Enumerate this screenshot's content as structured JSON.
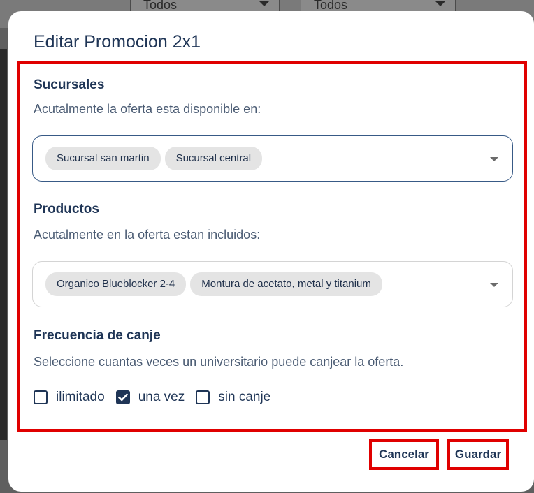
{
  "background": {
    "filter_a": "Todos",
    "filter_b": "Todos"
  },
  "modal": {
    "title": "Editar Promocion 2x1"
  },
  "sucursales": {
    "title": "Sucursales",
    "subtitle": "Acutalmente la oferta esta disponible en:",
    "chips": [
      "Sucursal san martin",
      "Sucursal central"
    ]
  },
  "productos": {
    "title": "Productos",
    "subtitle": "Acutalmente en la oferta estan incluidos:",
    "chips": [
      "Organico Blueblocker 2-4",
      "Montura de acetato, metal y titanium"
    ]
  },
  "frecuencia": {
    "title": "Frecuencia de canje",
    "subtitle": "Seleccione cuantas veces un universitario puede canjear la oferta.",
    "options": [
      {
        "label": "ilimitado",
        "checked": false
      },
      {
        "label": "una vez",
        "checked": true
      },
      {
        "label": "sin canje",
        "checked": false
      }
    ]
  },
  "actions": {
    "cancel_label": "Cancelar",
    "save_label": "Guardar"
  },
  "colors": {
    "primary": "#1f3556",
    "highlight": "#e00000",
    "chip_bg": "#e4e4e4"
  }
}
